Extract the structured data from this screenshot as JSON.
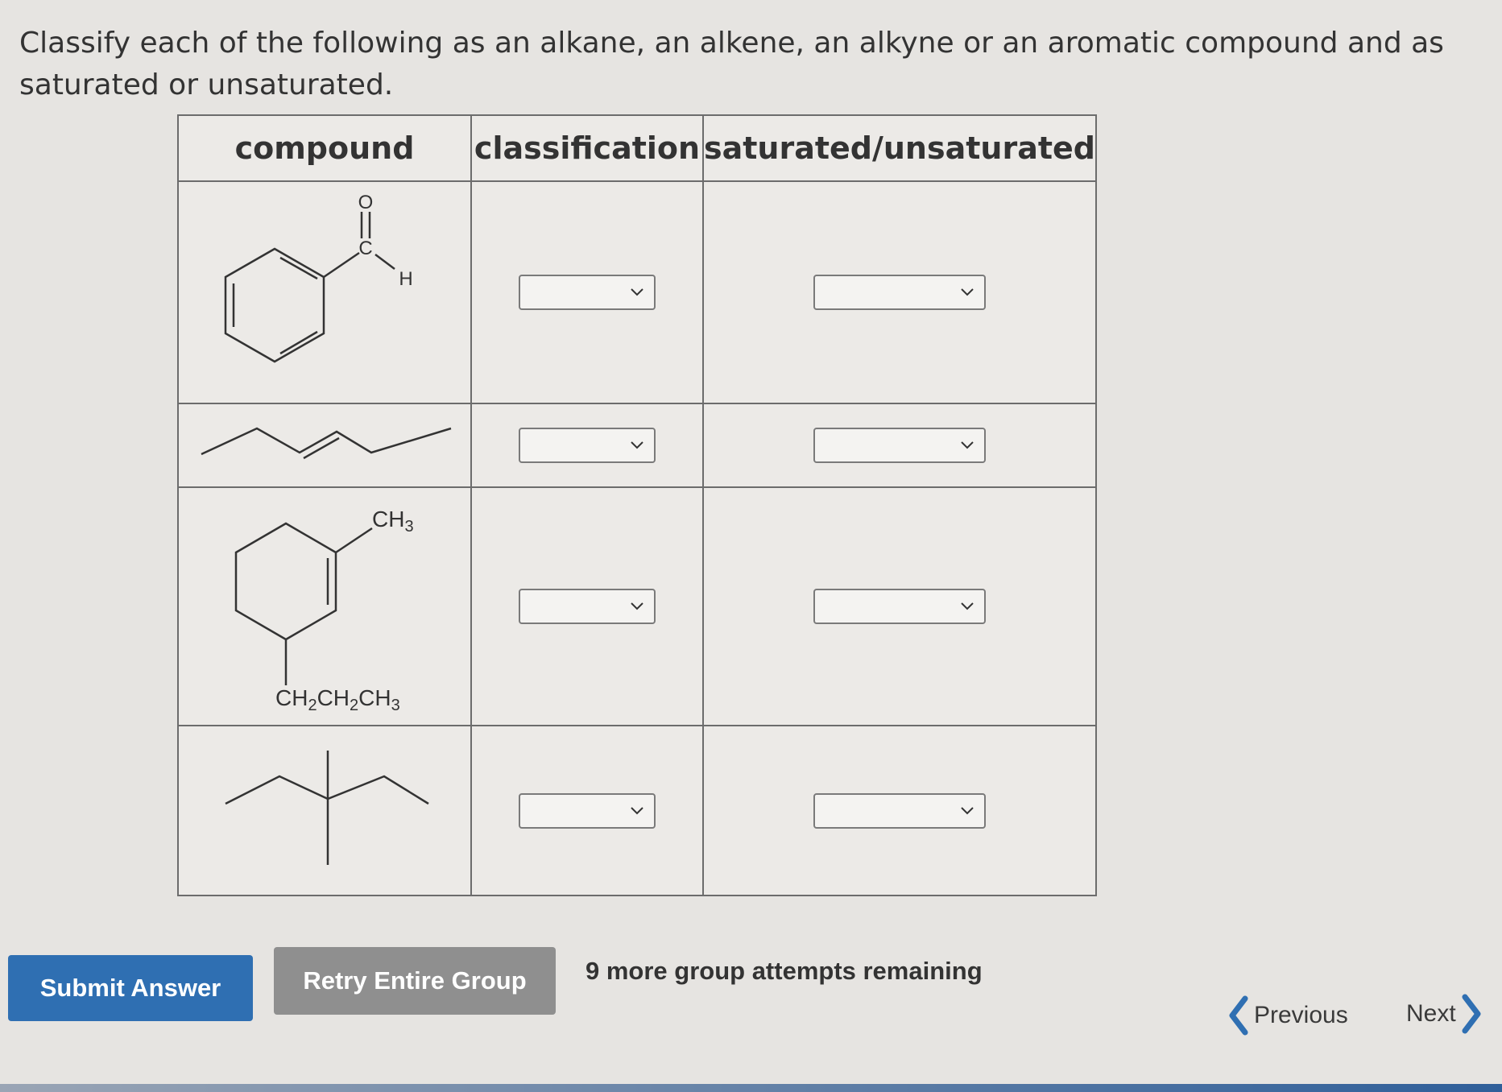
{
  "question": {
    "text": "Classify each of the following as an alkane, an alkene, an alkyne or an aromatic compound and as saturated or unsaturated."
  },
  "table": {
    "headers": [
      "compound",
      "classification",
      "saturated/unsaturated"
    ],
    "rows": [
      {
        "labels": {
          "oxygen": "O",
          "carbon": "C",
          "hydrogen": "H"
        },
        "classification_value": "",
        "saturation_value": ""
      },
      {
        "labels": {},
        "classification_value": "",
        "saturation_value": ""
      },
      {
        "labels": {
          "methyl": "CH3",
          "propyl": "CH2CH2CH3"
        },
        "classification_value": "",
        "saturation_value": ""
      },
      {
        "labels": {},
        "classification_value": "",
        "saturation_value": ""
      }
    ]
  },
  "actions": {
    "submit_label": "Submit Answer",
    "retry_label": "Retry Entire Group",
    "attempts_text": "9 more group attempts remaining"
  },
  "navigation": {
    "previous_label": "Previous",
    "next_label": "Next"
  },
  "colors": {
    "submit_bg": "#2f6fb2",
    "retry_bg": "#8f8f8f"
  }
}
